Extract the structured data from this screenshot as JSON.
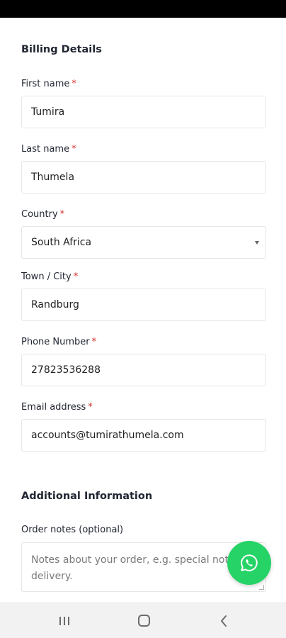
{
  "billing": {
    "title": "Billing Details",
    "required_mark": "*",
    "fields": [
      {
        "label": "First name",
        "value": "Tumira"
      },
      {
        "label": "Last name",
        "value": "Thumela"
      },
      {
        "label": "Country",
        "value": "South Africa"
      },
      {
        "label": "Town / City",
        "value": "Randburg"
      },
      {
        "label": "Phone Number",
        "value": "27823536288"
      },
      {
        "label": "Email address",
        "value": "accounts@tumirathumela.com"
      }
    ]
  },
  "additional": {
    "title": "Additional Information",
    "order_notes_label": "Order notes (optional)",
    "order_notes_placeholder": "Notes about your order, e.g. special notes for delivery."
  },
  "icons": {
    "whatsapp": "whatsapp-icon",
    "recents": "recent-apps-icon",
    "home": "home-icon",
    "back": "back-icon",
    "select_caret": "chevron-down-icon"
  },
  "colors": {
    "whatsapp_green": "#25d366",
    "required_red": "#d32f2f",
    "status_bar": "#000000",
    "nav_bar": "#f2f2f2"
  }
}
